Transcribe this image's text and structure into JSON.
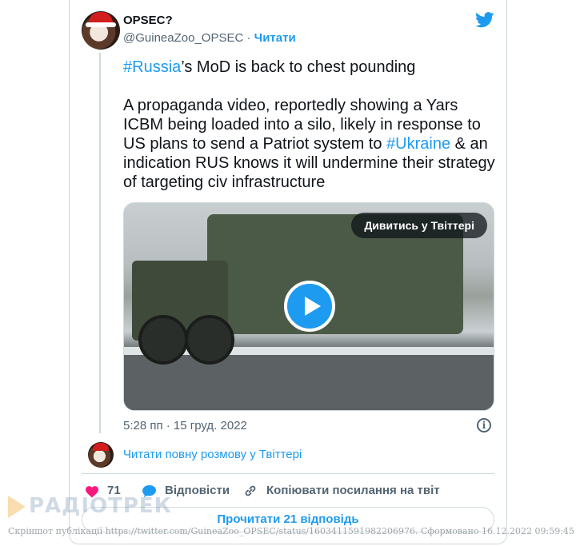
{
  "author": {
    "name": "OPSEC?",
    "handle": "@GuineaZoo_OPSEC",
    "separator": "·",
    "follow_label": "Читати"
  },
  "tweet": {
    "line1_tag": "#Russia",
    "line1_rest": "’s MoD is back to chest pounding",
    "body_part1": "A propaganda video, reportedly showing a Yars ICBM being loaded into a silo, likely in response to US plans to send a Patriot system to ",
    "body_tag": "#Ukraine",
    "body_part2": " & an indication RUS knows it will undermine their strategy of targeting civ infrastructure"
  },
  "media": {
    "watch_label": "Дивитись у Твіттері"
  },
  "timestamp": "5:28 пп · 15 груд. 2022",
  "info_glyph": "i",
  "read_conversation": "Читати повну розмову у Твіттері",
  "actions": {
    "likes_count": "71",
    "reply_label": "Відповісти",
    "copy_link_label": "Копіювати посилання на твіт"
  },
  "read_replies": "Прочитати 21 відповідь",
  "watermark": {
    "logo_text": "РАДІОТРЕК",
    "note": "Скріншот публікації https://twitter.com/GuineaZoo_OPSEC/status/1603411591982206976. Сформовано 16.12.2022 09:59:45"
  },
  "colors": {
    "accent": "#1d9bf0",
    "like": "#f91880",
    "muted": "#536471",
    "border": "#cfd9de"
  },
  "icons": [
    "twitter-bird-icon",
    "play-icon",
    "info-icon",
    "heart-icon",
    "reply-icon",
    "link-icon"
  ]
}
